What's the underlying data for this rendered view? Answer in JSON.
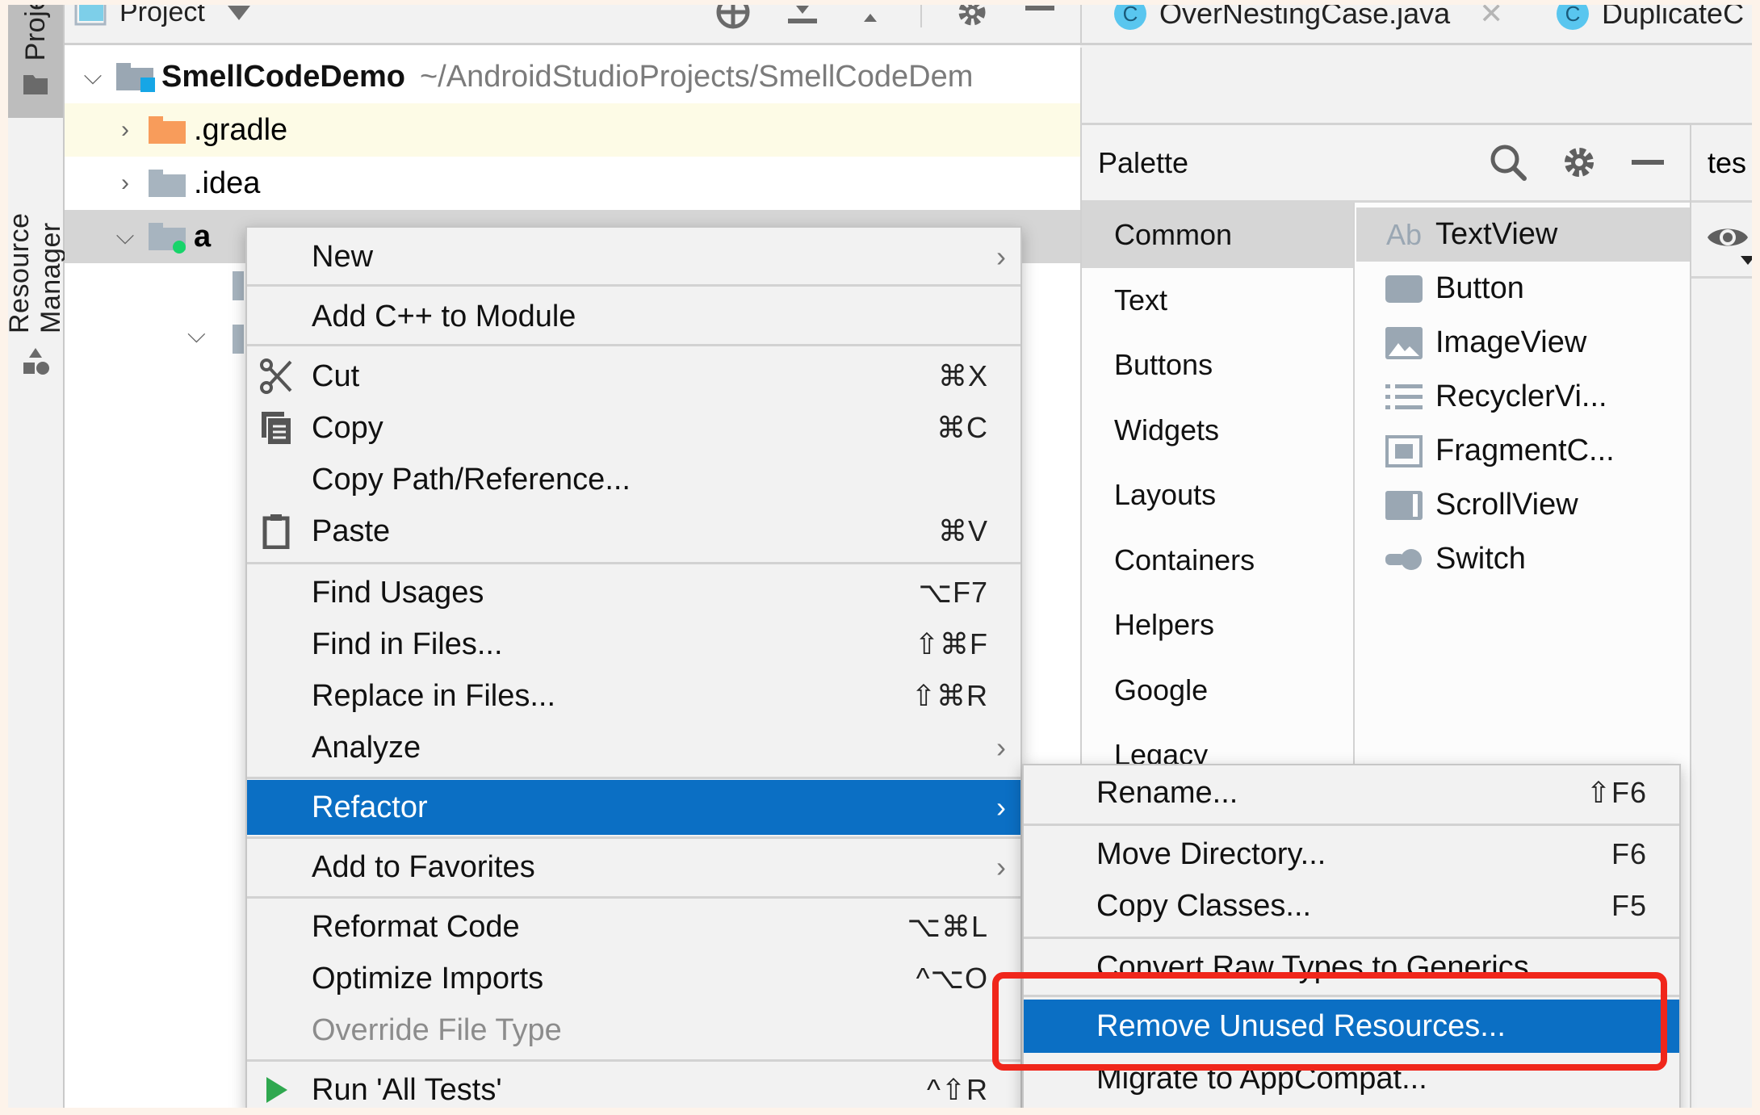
{
  "project_panel": {
    "header_title": "Project",
    "header_icons": [
      "locate-icon",
      "expand-all-icon",
      "collapse-all-icon",
      "gear-icon",
      "hide-icon"
    ],
    "tree": [
      {
        "name": "SmellCodeDemo",
        "path": "~/AndroidStudioProjects/SmellCodeDem",
        "expanded": true,
        "bold": true
      },
      {
        "name": ".gradle",
        "expanded": false,
        "folder_color": "#f89c5b"
      },
      {
        "name": ".idea",
        "expanded": false
      },
      {
        "name": "a",
        "expanded": true,
        "selected": true
      }
    ]
  },
  "tool_strip": {
    "tabs": [
      {
        "label": "Project",
        "active": true
      },
      {
        "label": "Resource Manager",
        "active": false
      }
    ]
  },
  "editor_tabs": [
    {
      "label": "OverNestingCase.java",
      "badge": "C",
      "closable": true
    },
    {
      "label": "DuplicateC",
      "badge": "C"
    }
  ],
  "palette": {
    "title": "Palette",
    "categories": [
      "Common",
      "Text",
      "Buttons",
      "Widgets",
      "Layouts",
      "Containers",
      "Helpers",
      "Google",
      "Legacy"
    ],
    "selected_category": "Common",
    "items": [
      {
        "label": "TextView",
        "icon": "textview-icon",
        "glyph": "Ab"
      },
      {
        "label": "Button",
        "icon": "button-icon"
      },
      {
        "label": "ImageView",
        "icon": "imageview-icon"
      },
      {
        "label": "RecyclerVi...",
        "icon": "list-icon"
      },
      {
        "label": "FragmentC...",
        "icon": "fragment-icon"
      },
      {
        "label": "ScrollView",
        "icon": "scrollview-icon"
      },
      {
        "label": "Switch",
        "icon": "switch-icon"
      }
    ],
    "selected_item": "TextView"
  },
  "right_strip": {
    "title": "tes"
  },
  "context_menu": {
    "items": [
      {
        "label": "New",
        "submenu": true
      },
      {
        "label": "Add C++ to Module"
      },
      {
        "label": "Cut",
        "shortcut": "⌘X",
        "icon": "scissors-icon"
      },
      {
        "label": "Copy",
        "shortcut": "⌘C",
        "icon": "copy-icon"
      },
      {
        "label": "Copy Path/Reference..."
      },
      {
        "label": "Paste",
        "shortcut": "⌘V",
        "icon": "clipboard-icon"
      },
      {
        "label": "Find Usages",
        "shortcut": "⌥F7"
      },
      {
        "label": "Find in Files...",
        "shortcut": "⇧⌘F"
      },
      {
        "label": "Replace in Files...",
        "shortcut": "⇧⌘R"
      },
      {
        "label": "Analyze",
        "submenu": true
      },
      {
        "label": "Refactor",
        "submenu": true,
        "highlighted": true
      },
      {
        "label": "Add to Favorites",
        "submenu": true
      },
      {
        "label": "Reformat Code",
        "shortcut": "⌥⌘L"
      },
      {
        "label": "Optimize Imports",
        "shortcut": "^⌥O"
      },
      {
        "label": "Override File Type",
        "disabled": true
      },
      {
        "label": "Run 'All Tests'",
        "shortcut": "^⇧R",
        "icon": "run-icon"
      }
    ]
  },
  "refactor_submenu": {
    "items": [
      {
        "label": "Rename...",
        "shortcut": "⇧F6"
      },
      {
        "label": "Move Directory...",
        "shortcut": "F6"
      },
      {
        "label": "Copy Classes...",
        "shortcut": "F5"
      },
      {
        "label": "Convert Raw Types to Generics"
      },
      {
        "label": "Remove Unused Resources...",
        "highlighted": true,
        "annotated": true
      },
      {
        "label": "Migrate to AppCompat..."
      }
    ]
  },
  "colors": {
    "menu_highlight": "#0b6fc4",
    "annotation_red": "#f0261b",
    "run_green": "#2fa84f",
    "module_dot": "#17d46a"
  }
}
